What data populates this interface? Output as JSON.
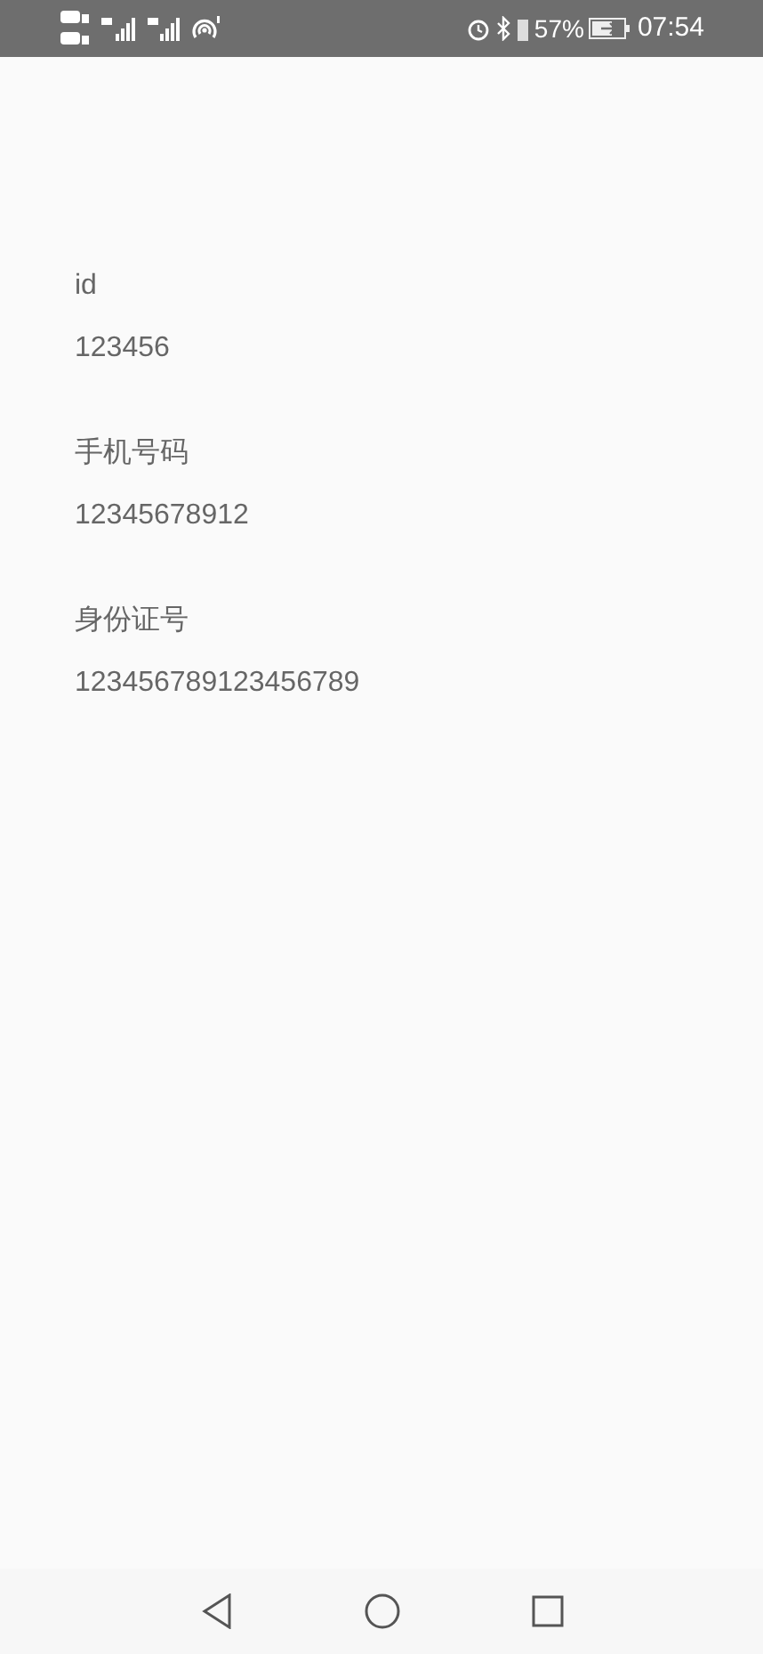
{
  "status_bar": {
    "battery": "57%",
    "time": "07:54"
  },
  "fields": [
    {
      "label": "id",
      "value": "123456"
    },
    {
      "label": "手机号码",
      "value": "12345678912"
    },
    {
      "label": "身份证号",
      "value": "123456789123456789"
    }
  ]
}
